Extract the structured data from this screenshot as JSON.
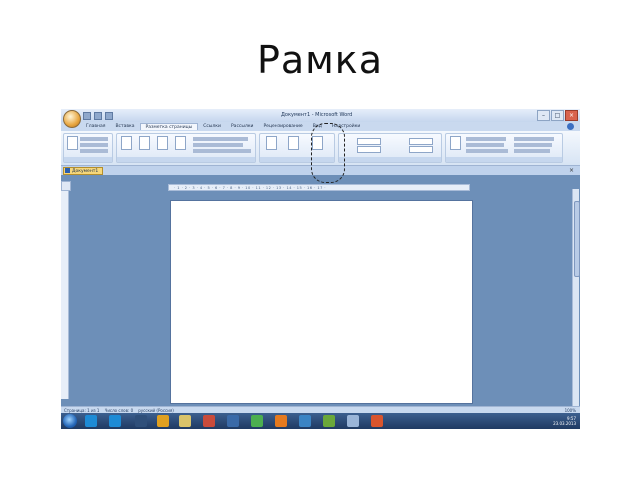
{
  "slide": {
    "title": "Рамка"
  },
  "window": {
    "title": "Документ1 - Microsoft Word"
  },
  "ribbon": {
    "tabs": [
      "Главная",
      "Вставка",
      "Разметка страницы",
      "Ссылки",
      "Рассылки",
      "Рецензирование",
      "Вид",
      "Надстройки"
    ],
    "active_tab": "Разметка страницы"
  },
  "document": {
    "tab_label": "Документ1"
  },
  "statusbar": {
    "page_info": "Страница: 1 из 1",
    "words": "Число слов: 0",
    "language": "русский (Россия)",
    "zoom": "100%"
  },
  "taskbar": {
    "time": "9:57",
    "date": "23.03.2013"
  },
  "colors": {
    "highlight_border": "#222222",
    "ribbon_bg": "#dfe9f6",
    "workspace": "#6d8fb8"
  }
}
